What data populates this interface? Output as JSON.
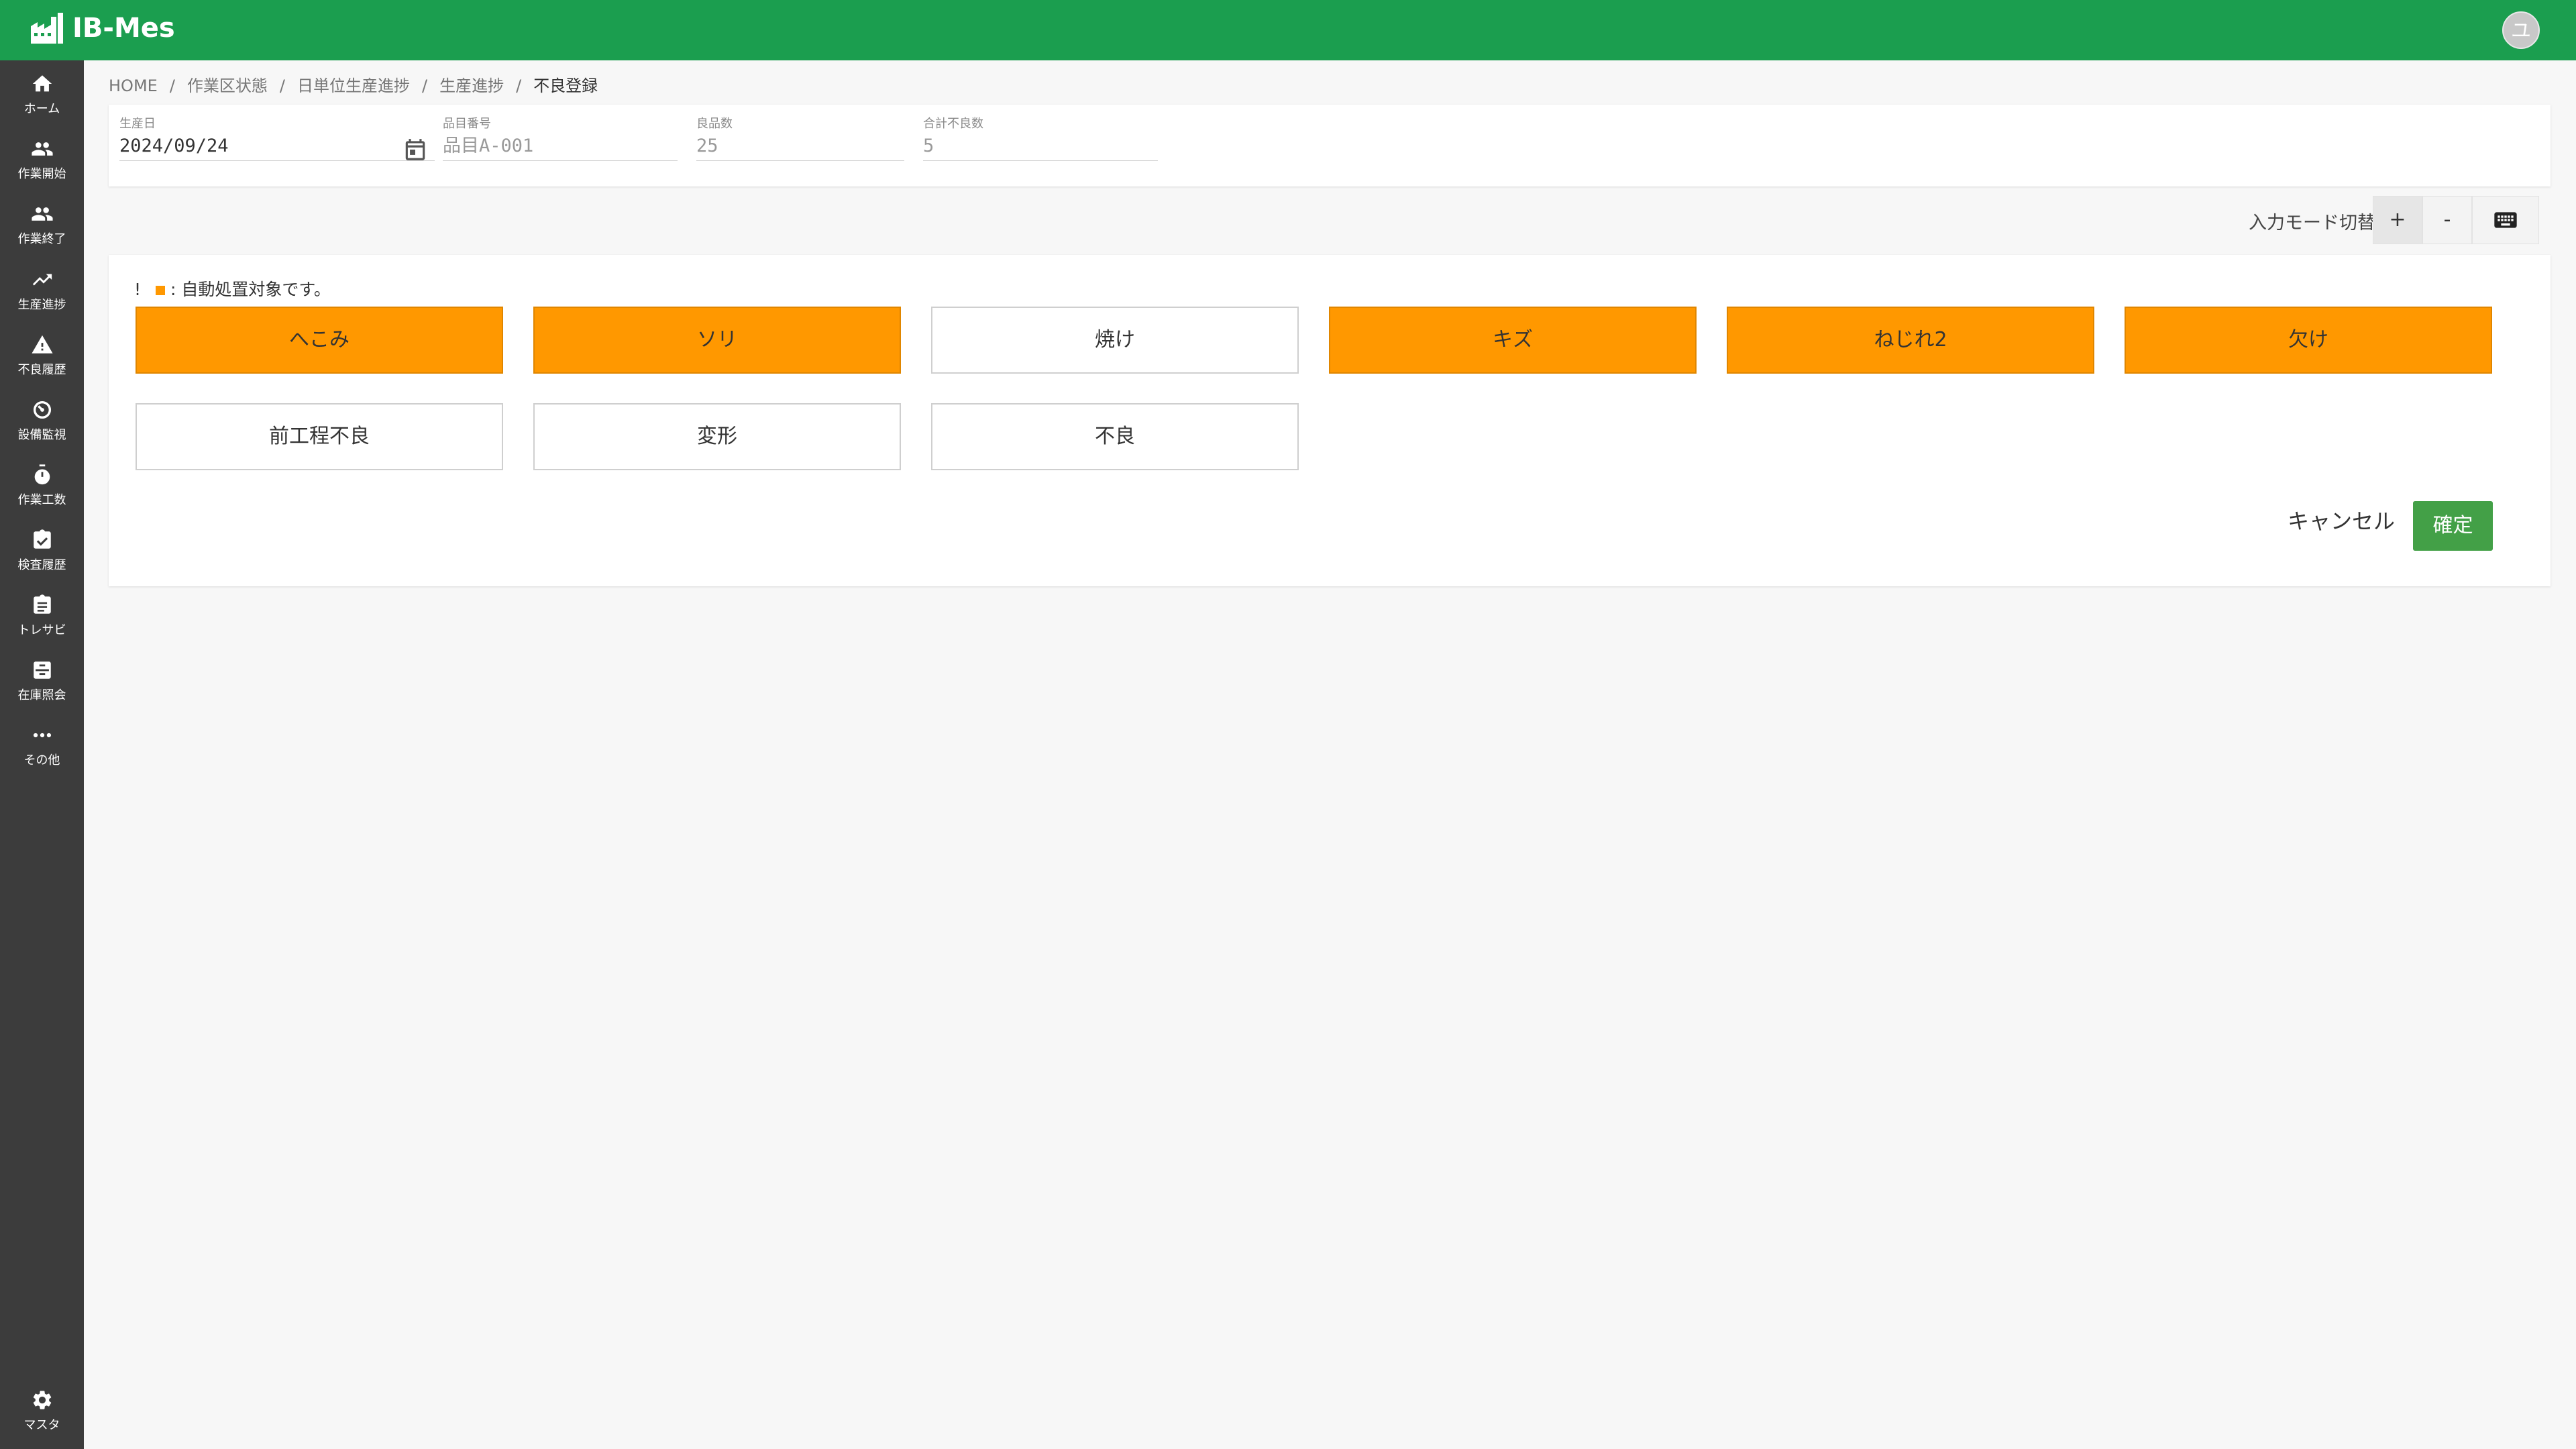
{
  "app": {
    "title": "IB-Mes",
    "avatar_initial": "ユ",
    "brand_color": "#1b9e4f"
  },
  "sidebar": {
    "items": [
      {
        "label": "ホーム",
        "icon": "home-icon"
      },
      {
        "label": "作業開始",
        "icon": "people-icon"
      },
      {
        "label": "作業終了",
        "icon": "people-icon"
      },
      {
        "label": "生産進捗",
        "icon": "trending-up-icon"
      },
      {
        "label": "不良履歴",
        "icon": "warning-icon"
      },
      {
        "label": "設備監視",
        "icon": "gauge-icon"
      },
      {
        "label": "作業工数",
        "icon": "stopwatch-icon"
      },
      {
        "label": "検査履歴",
        "icon": "clipboard-check-icon"
      },
      {
        "label": "トレサビ",
        "icon": "clipboard-icon"
      },
      {
        "label": "在庫照会",
        "icon": "inbox-icon"
      },
      {
        "label": "その他",
        "icon": "more-icon"
      }
    ],
    "bottom": {
      "label": "マスタ",
      "icon": "gear-icon"
    }
  },
  "breadcrumb": {
    "items": [
      "HOME",
      "作業区状態",
      "日単位生産進捗",
      "生産進捗"
    ],
    "current": "不良登録"
  },
  "info": {
    "production_date": {
      "label": "生産日",
      "value": "2024/09/24"
    },
    "item_code": {
      "label": "品目番号",
      "value": "品目A-001"
    },
    "good_count": {
      "label": "良品数",
      "value": "25"
    },
    "total_defect": {
      "label": "合計不良数",
      "value": "5"
    }
  },
  "input_mode": {
    "label": "入力モード切替",
    "plus": "+",
    "minus": "-",
    "keyboard_icon": "keyboard-icon"
  },
  "notice": {
    "prefix": "!",
    "text": ": 自動処置対象です。",
    "marker_color": "#ff9800"
  },
  "defects": [
    {
      "label": "へこみ",
      "auto": true
    },
    {
      "label": "ソリ",
      "auto": true
    },
    {
      "label": "焼け",
      "auto": false
    },
    {
      "label": "キズ",
      "auto": true
    },
    {
      "label": "ねじれ2",
      "auto": true
    },
    {
      "label": "欠け",
      "auto": true
    },
    {
      "label": "前工程不良",
      "auto": false
    },
    {
      "label": "変形",
      "auto": false
    },
    {
      "label": "不良",
      "auto": false
    }
  ],
  "actions": {
    "cancel": "キャンセル",
    "confirm": "確定",
    "confirm_color": "#43a047"
  }
}
